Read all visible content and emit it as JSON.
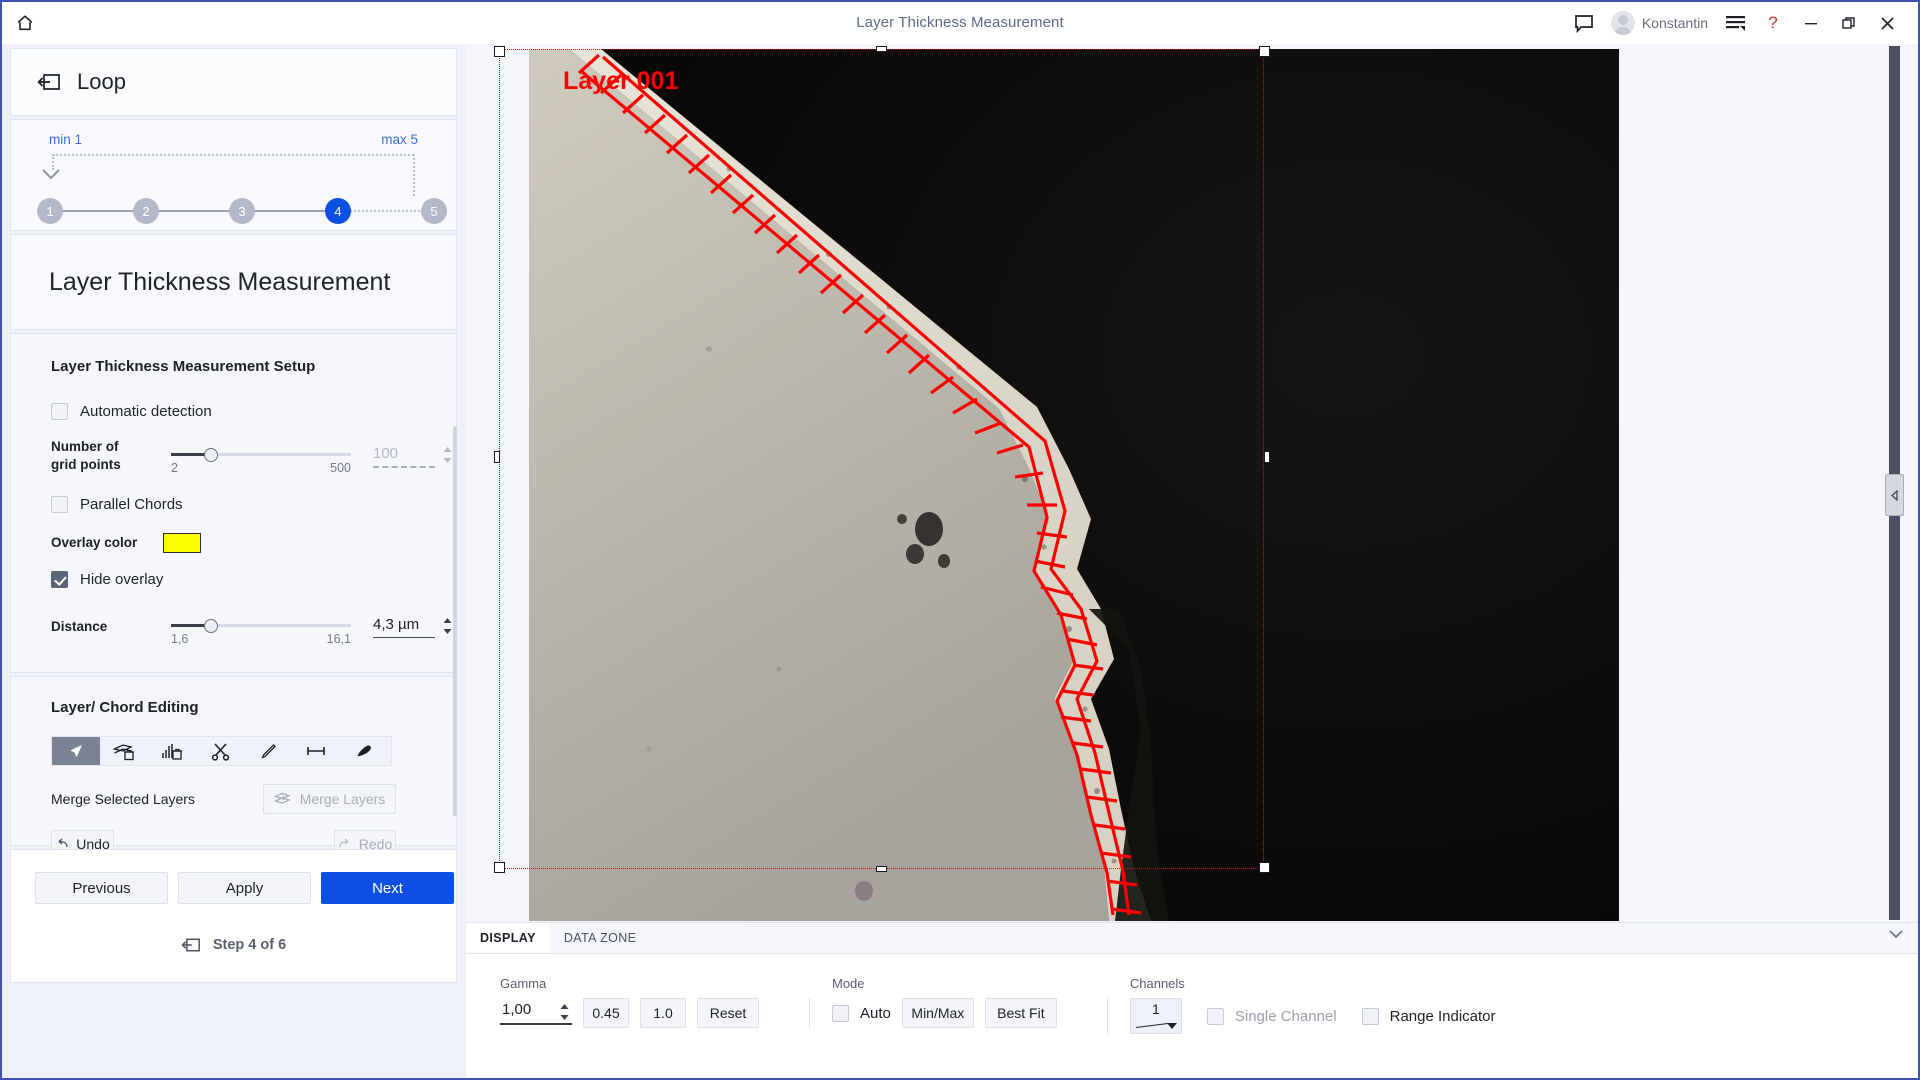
{
  "titlebar": {
    "home_icon": "home-icon",
    "title": "Layer Thickness Measurement",
    "comment_icon": "comment-icon",
    "user_name": "Konstantin",
    "menu_icon": "hamburger-menu-icon",
    "help_label": "?",
    "minimize_label": "minimize-icon",
    "restore_label": "restore-icon",
    "close_label": "close-icon"
  },
  "loop": {
    "icon": "loop-icon",
    "title": "Loop",
    "min_label": "min 1",
    "max_label": "max 5",
    "steps": [
      "1",
      "2",
      "3",
      "4",
      "5"
    ],
    "active_step": "4"
  },
  "page": {
    "heading": "Layer Thickness Measurement"
  },
  "setup": {
    "section_title": "Layer Thickness Measurement Setup",
    "automatic_detection": {
      "label": "Automatic detection",
      "checked": false
    },
    "grid_points": {
      "label_line1": "Number of",
      "label_line2": "grid points",
      "min": "2",
      "max": "500",
      "value": "100",
      "fill_percent": 20
    },
    "parallel_chords": {
      "label": "Parallel Chords",
      "checked": false
    },
    "overlay_color": {
      "label": "Overlay color",
      "color": "#ffff00"
    },
    "hide_overlay": {
      "label": "Hide overlay",
      "checked": true
    },
    "distance": {
      "label": "Distance",
      "min": "1,6",
      "max": "16,1",
      "value": "4,3 µm",
      "fill_percent": 20
    }
  },
  "editing": {
    "section_title": "Layer/ Chord Editing",
    "tools": [
      {
        "name": "select-arrow-tool",
        "selected": true
      },
      {
        "name": "delete-layer-tool",
        "selected": false
      },
      {
        "name": "delete-chords-tool",
        "selected": false
      },
      {
        "name": "cut-scissors-tool",
        "selected": false
      },
      {
        "name": "draw-pencil-tool",
        "selected": false
      },
      {
        "name": "measure-distance-tool",
        "selected": false
      },
      {
        "name": "eraser-tool",
        "selected": false
      }
    ],
    "merge_label": "Merge Selected Layers",
    "merge_button": "Merge Layers",
    "merge_button_enabled": false,
    "undo_button": "Undo",
    "redo_button": "Redo",
    "redo_enabled": false
  },
  "navigation": {
    "previous": "Previous",
    "apply": "Apply",
    "next": "Next",
    "step_text": "Step 4 of 6",
    "step_icon": "loop-icon"
  },
  "viewer": {
    "overlay_label": "Layer 001",
    "overlay_label_color": "#ff0000",
    "chord_color": "#ff0000",
    "selection_color": "#d01414",
    "collapse_handle_icon": "chevron-left-icon"
  },
  "dock": {
    "tabs": [
      {
        "label": "DISPLAY",
        "active": true
      },
      {
        "label": "DATA ZONE",
        "active": false
      }
    ],
    "collapse_icon": "chevron-down-icon",
    "gamma": {
      "label": "Gamma",
      "value": "1,00",
      "preset_045": "0.45",
      "preset_10": "1.0",
      "reset": "Reset"
    },
    "mode": {
      "label": "Mode",
      "auto_label": "Auto",
      "auto_checked": false,
      "minmax": "Min/Max",
      "bestfit": "Best Fit"
    },
    "channels": {
      "label": "Channels",
      "value": "1",
      "single_channel_label": "Single Channel",
      "single_channel_checked": false,
      "single_channel_enabled": false,
      "range_indicator_label": "Range Indicator",
      "range_indicator_checked": false
    }
  }
}
